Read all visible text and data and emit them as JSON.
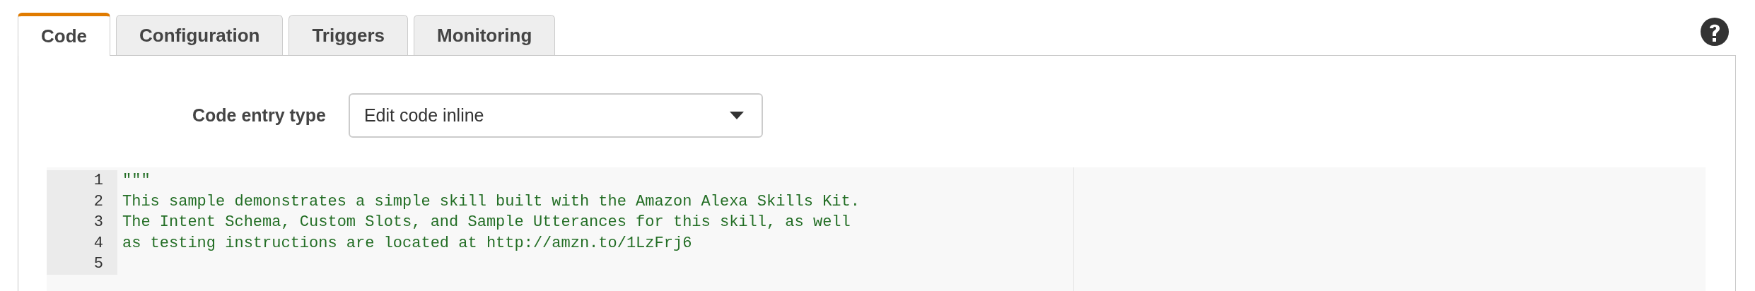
{
  "tabs": [
    {
      "label": "Code",
      "selected": true
    },
    {
      "label": "Configuration",
      "selected": false
    },
    {
      "label": "Triggers",
      "selected": false
    },
    {
      "label": "Monitoring",
      "selected": false
    }
  ],
  "code_entry_type": {
    "label": "Code entry type",
    "value": "Edit code inline"
  },
  "editor": {
    "lines": [
      {
        "number": "1",
        "text": "\"\"\""
      },
      {
        "number": "2",
        "text": "This sample demonstrates a simple skill built with the Amazon Alexa Skills Kit."
      },
      {
        "number": "3",
        "text": "The Intent Schema, Custom Slots, and Sample Utterances for this skill, as well"
      },
      {
        "number": "4",
        "text": "as testing instructions are located at http://amzn.to/1LzFrj6"
      },
      {
        "number": "5"
      }
    ]
  }
}
